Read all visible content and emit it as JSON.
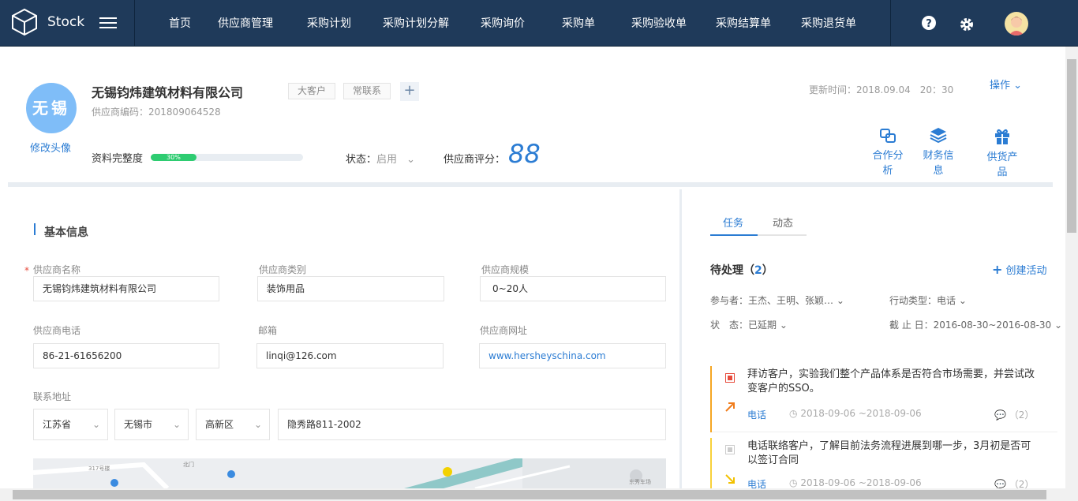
{
  "app": {
    "name": "Stock"
  },
  "nav": [
    "首页",
    "供应商管理",
    "采购计划",
    "采购计划分解",
    "采购询价",
    "采购单",
    "采购验收单",
    "采购结算单",
    "采购退货单"
  ],
  "profile": {
    "avatar_text": "无锡",
    "change_avatar": "修改头像",
    "company": "无锡钧炜建筑材料有限公司",
    "tags": [
      "大客户",
      "常联系"
    ],
    "code_label": "供应商编码：",
    "code": "201809064528",
    "update_label": "更新时间：",
    "update_time": "2018.09.04　20：30",
    "ops": "操作",
    "completeness_label": "资料完整度",
    "completeness_percent": 30,
    "completeness_text": "30%",
    "status_label": "状态：",
    "status_value": "启用",
    "score_label": "供应商评分：",
    "score": "88"
  },
  "quick_actions": [
    "合作分析",
    "财务信息",
    "供货产品"
  ],
  "basic": {
    "title": "基本信息",
    "labels": [
      "供应商名称",
      "供应商类别",
      "供应商规模",
      "供应商电话",
      "邮箱",
      "供应商网址",
      "联系地址"
    ],
    "required_mark": "*",
    "name": "无锡钧炜建筑材料有限公司",
    "category": "装饰用品",
    "scale": "0~20人",
    "phone": "86-21-61656200",
    "email": "linqi@126.com",
    "website": "www.hersheyschina.com",
    "province": "江苏省",
    "city": "无锡市",
    "district": "高新区",
    "address": "隐秀路811-2002"
  },
  "map": {
    "labels": [
      "北门",
      "317号楼",
      "东秀车场"
    ]
  },
  "right": {
    "tabs": [
      "任务",
      "动态"
    ],
    "pending_label": "待处理（",
    "pending_count": "2",
    "pending_close": "）",
    "create": "创建活动",
    "filters": [
      {
        "label": "参与者：",
        "value": "王杰、王明、张颖…"
      },
      {
        "label": "行动类型：",
        "value": "电话"
      },
      {
        "label": "状　态：",
        "value": "已延期"
      },
      {
        "label": "截 止 日：",
        "value": "2016-08-30~2016-08-30"
      }
    ],
    "tasks": [
      {
        "text": "拜访客户，实验我们整个产品体系是否符合市场需要，并尝试改变客户的SSO。",
        "type": "电话",
        "time": "2018-09-06 ~2018-09-06",
        "comments": "（2）",
        "color": "#f5a623"
      },
      {
        "text": "电话联络客户，了解目前法务流程进展到哪一步，3月初是否可以签订合同",
        "type": "电话",
        "time": "2018-09-06 ~2018-09-06",
        "comments": "（2）",
        "color": "#f8d13a"
      }
    ]
  }
}
